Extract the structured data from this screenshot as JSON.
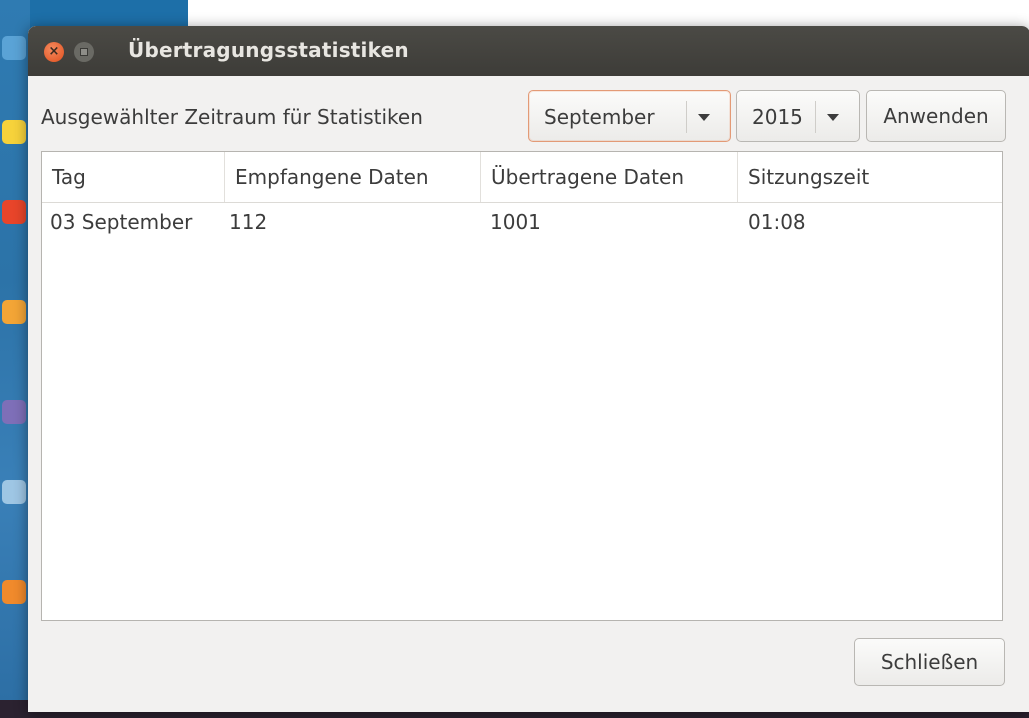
{
  "window": {
    "title": "Übertragungsstatistiken"
  },
  "toolbar": {
    "period_label": "Ausgewählter Zeitraum für Statistiken",
    "month_value": "September",
    "year_value": "2015",
    "apply_label": "Anwenden"
  },
  "table": {
    "columns": [
      "Tag",
      "Empfangene Daten",
      "Übertragene Daten",
      "Sitzungszeit"
    ],
    "rows": [
      [
        "03 September",
        "112",
        "1001",
        "01:08"
      ]
    ]
  },
  "footer": {
    "close_label": "Schließen"
  },
  "colors": {
    "titlebar": "#3d3c38",
    "window_bg": "#f2f1f0",
    "close_button": "#e0501e",
    "focus_border": "#e39a76"
  },
  "icons": {
    "titlebar_close": "close-icon",
    "titlebar_maximize": "maximize-icon",
    "combo_arrow": "chevron-down-icon"
  }
}
